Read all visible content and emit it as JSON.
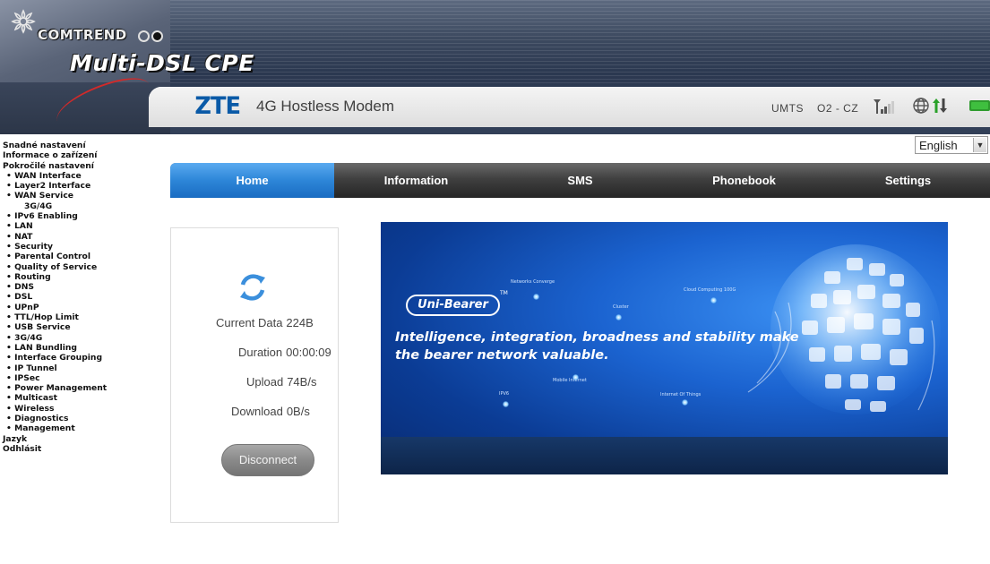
{
  "header": {
    "brand": "COMTREND",
    "product": "Multi-DSL CPE"
  },
  "modem_bar": {
    "logo": "ZTE",
    "title": "4G Hostless Modem",
    "network_type": "UMTS",
    "operator": "O2 - CZ",
    "icons": [
      "signal-icon",
      "globe-icon",
      "data-updown-icon",
      "battery-icon"
    ]
  },
  "sidebar": {
    "items": [
      {
        "label": "Snadné nastavení",
        "level": "top"
      },
      {
        "label": "Informace o zařízení",
        "level": "top"
      },
      {
        "label": "Pokročilé nastavení",
        "level": "top"
      },
      {
        "label": "WAN Interface",
        "level": "sub"
      },
      {
        "label": "Layer2 Interface",
        "level": "sub"
      },
      {
        "label": "WAN Service",
        "level": "sub"
      },
      {
        "label": "3G/4G",
        "level": "subsub"
      },
      {
        "label": "IPv6 Enabling",
        "level": "sub"
      },
      {
        "label": "LAN",
        "level": "sub"
      },
      {
        "label": "NAT",
        "level": "sub"
      },
      {
        "label": "Security",
        "level": "sub"
      },
      {
        "label": "Parental Control",
        "level": "sub"
      },
      {
        "label": "Quality of Service",
        "level": "sub"
      },
      {
        "label": "Routing",
        "level": "sub"
      },
      {
        "label": "DNS",
        "level": "sub"
      },
      {
        "label": "DSL",
        "level": "sub"
      },
      {
        "label": "UPnP",
        "level": "sub"
      },
      {
        "label": "TTL/Hop Limit",
        "level": "sub"
      },
      {
        "label": "USB Service",
        "level": "sub"
      },
      {
        "label": "3G/4G",
        "level": "sub"
      },
      {
        "label": "LAN Bundling",
        "level": "sub"
      },
      {
        "label": "Interface Grouping",
        "level": "sub"
      },
      {
        "label": "IP Tunnel",
        "level": "sub"
      },
      {
        "label": "IPSec",
        "level": "sub"
      },
      {
        "label": "Power Management",
        "level": "sub"
      },
      {
        "label": "Multicast",
        "level": "sub"
      },
      {
        "label": "Wireless",
        "level": "sub"
      },
      {
        "label": "Diagnostics",
        "level": "sub"
      },
      {
        "label": "Management",
        "level": "sub"
      },
      {
        "label": "Jazyk",
        "level": "top"
      },
      {
        "label": "Odhlásit",
        "level": "top"
      }
    ]
  },
  "language": {
    "selected": "English"
  },
  "nav": {
    "tabs": [
      {
        "label": "Home",
        "active": true
      },
      {
        "label": "Information",
        "active": false
      },
      {
        "label": "SMS",
        "active": false
      },
      {
        "label": "Phonebook",
        "active": false
      },
      {
        "label": "Settings",
        "active": false
      }
    ]
  },
  "status": {
    "current_data_label": "Current Data",
    "current_data_value": "224B",
    "duration_label": "Duration",
    "duration_value": "00:00:09",
    "upload_label": "Upload",
    "upload_value": "74B/s",
    "download_label": "Download",
    "download_value": "0B/s",
    "disconnect_label": "Disconnect"
  },
  "ad": {
    "logo": "Uni-Bearer",
    "trademark": "TM",
    "slogan_line1": "Intelligence, integration, broadness and stability make",
    "slogan_line2": "the bearer network valuable.",
    "tags": [
      "Networks Converge",
      "Cluster",
      "Cloud Computing 100G",
      "Mobile Internet",
      "IPV6",
      "Internet Of Things"
    ]
  },
  "colors": {
    "nav_active": "#2d86d8",
    "nav_bg": "#404040",
    "zte_blue": "#0a5aa7",
    "ad_blue": "#1b63d0"
  }
}
